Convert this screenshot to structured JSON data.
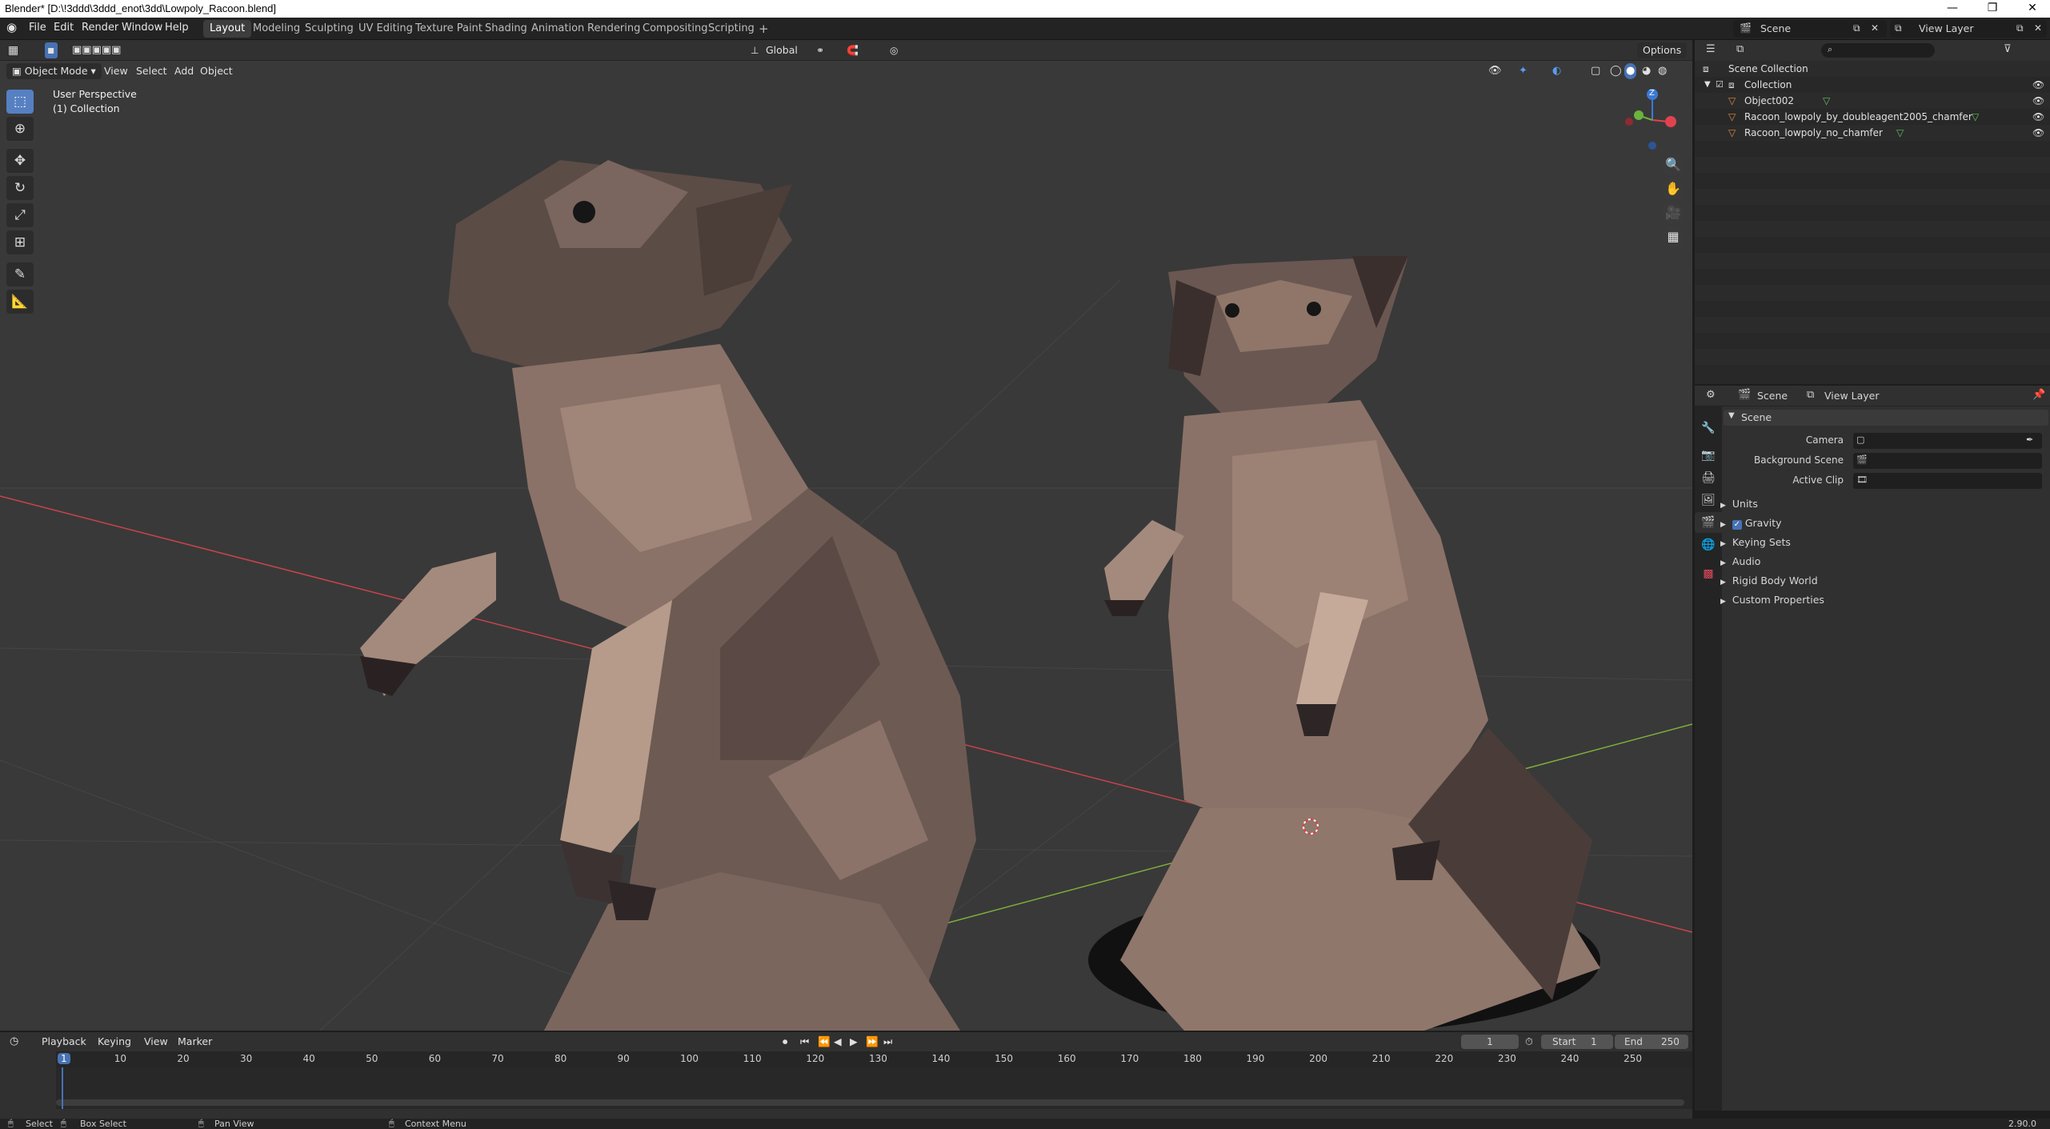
{
  "window": {
    "title": "Blender* [D:\\!3ddd\\3ddd_enot\\3dd\\Lowpoly_Racoon.blend]",
    "minimize": "—",
    "maximize": "❐",
    "close": "✕"
  },
  "menu": [
    "File",
    "Edit",
    "Render",
    "Window",
    "Help"
  ],
  "workspaces": [
    "Layout",
    "Modeling",
    "Sculpting",
    "UV Editing",
    "Texture Paint",
    "Shading",
    "Animation",
    "Rendering",
    "Compositing",
    "Scripting"
  ],
  "workspace_add": "+",
  "scene_selector": {
    "label": "Scene"
  },
  "viewlayer_selector": {
    "label": "View Layer"
  },
  "viewport": {
    "mode": "Object Mode",
    "menus": [
      "View",
      "Select",
      "Add",
      "Object"
    ],
    "transform_orientation": "Global",
    "options": "Options",
    "perspective_label": "User Perspective",
    "collection_label": "(1) Collection",
    "gizmo_axes": {
      "z": "Z",
      "x_color": "#e0434e",
      "y_color": "#6bb33d",
      "z_color": "#3a7ad6"
    }
  },
  "outliner": {
    "search_placeholder": "",
    "items": [
      {
        "label": "Scene Collection"
      },
      {
        "label": "Collection"
      },
      {
        "label": "Object002"
      },
      {
        "label": "Racoon_lowpoly_by_doubleagent2005_chamfer"
      },
      {
        "label": "Racoon_lowpoly_no_chamfer"
      }
    ]
  },
  "properties": {
    "breadcrumb_scene": "Scene",
    "breadcrumb_viewlayer": "View Layer",
    "section": "Scene",
    "fields": [
      {
        "label": "Camera",
        "value": ""
      },
      {
        "label": "Background Scene",
        "value": ""
      },
      {
        "label": "Active Clip",
        "value": ""
      }
    ],
    "subsections": [
      "Units",
      "Gravity",
      "Keying Sets",
      "Audio",
      "Rigid Body World",
      "Custom Properties"
    ],
    "gravity_checked": true
  },
  "timeline": {
    "menus": [
      "Playback",
      "Keying",
      "View",
      "Marker"
    ],
    "current_frame": "1",
    "start_label": "Start",
    "start_value": "1",
    "end_label": "End",
    "end_value": "250",
    "ruler": [
      "1",
      "10",
      "20",
      "30",
      "40",
      "50",
      "60",
      "70",
      "80",
      "90",
      "100",
      "110",
      "120",
      "130",
      "140",
      "150",
      "160",
      "170",
      "180",
      "190",
      "200",
      "210",
      "220",
      "230",
      "240",
      "250"
    ]
  },
  "statusbar": {
    "select": "Select",
    "box_select": "Box Select",
    "pan_view": "Pan View",
    "context_menu": "Context Menu",
    "version": "2.90.0"
  },
  "colors": {
    "accent": "#5680c2",
    "active_frame": "#4772b3",
    "mesh_light": "#a08678",
    "mesh_dark": "#3a3030"
  }
}
